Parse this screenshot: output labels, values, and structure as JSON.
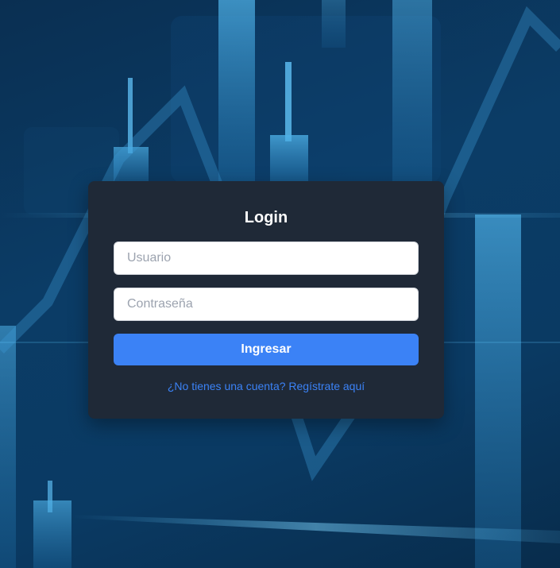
{
  "login": {
    "title": "Login",
    "username_placeholder": "Usuario",
    "username_value": "",
    "password_placeholder": "Contraseña",
    "password_value": "",
    "submit_label": "Ingresar",
    "register_link": "¿No tienes una cuenta? Regístrate aquí"
  },
  "colors": {
    "card_bg": "#1f2937",
    "button_bg": "#3b82f6",
    "link": "#3b82f6",
    "background": "#0b3c66"
  },
  "background_image": "stock-candlestick-chart"
}
